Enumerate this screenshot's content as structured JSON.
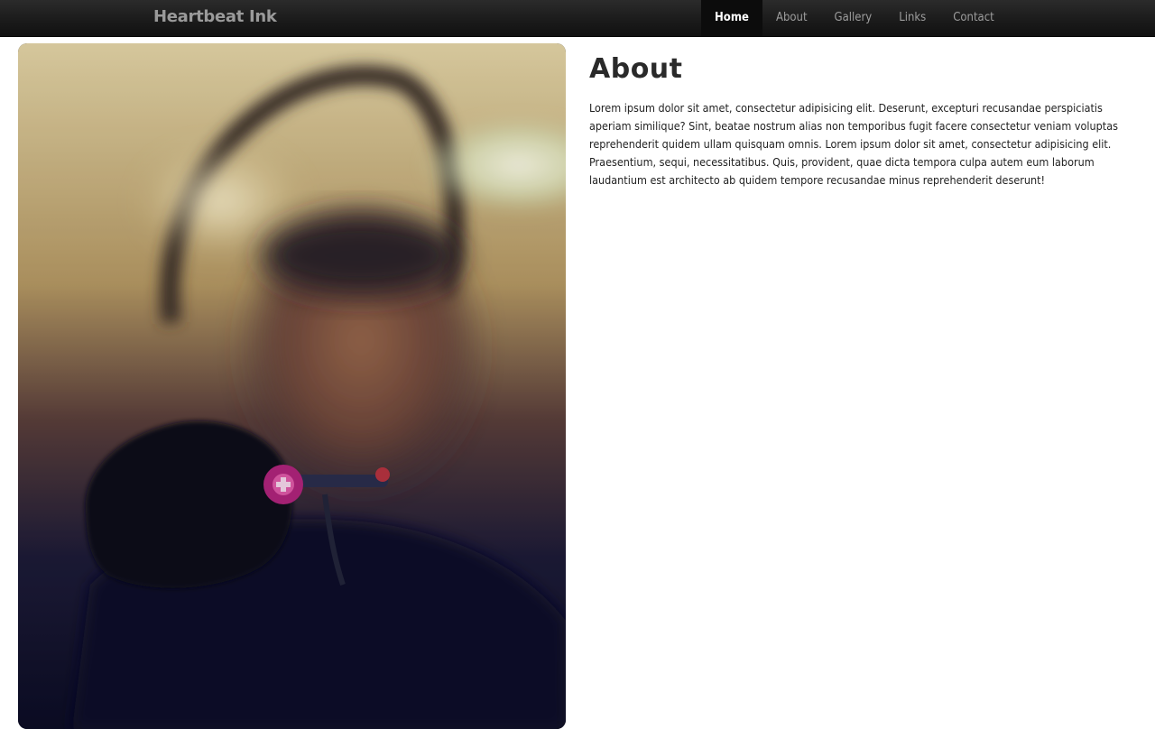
{
  "navbar": {
    "brand": "Heartbeat Ink",
    "items": [
      {
        "label": "Home",
        "active": true
      },
      {
        "label": "About",
        "active": false
      },
      {
        "label": "Gallery",
        "active": false
      },
      {
        "label": "Links",
        "active": false
      },
      {
        "label": "Contact",
        "active": false
      }
    ]
  },
  "main": {
    "heading": "About",
    "paragraph": "Lorem ipsum dolor sit amet, consectetur adipisicing elit. Deserunt, excepturi recusandae perspiciatis aperiam similique? Sint, beatae nostrum alias non temporibus fugit facere consectetur veniam voluptas reprehenderit quidem ullam quisquam omnis. Lorem ipsum dolor sit amet, consectetur adipisicing elit. Praesentium, sequi, necessitatibus. Quis, provident, quae dicta tempora culpa autem eum laborum laudantium est architecto ab quidem tempore recusandae minus reprehenderit deserunt!"
  },
  "colors": {
    "navbar_bg": "#1a1a1a",
    "nav_active_bg": "#0c0c0c",
    "nav_text": "#9d9d9d",
    "brand_text": "#9a9a9a",
    "heading_text": "#2a2a2a"
  }
}
